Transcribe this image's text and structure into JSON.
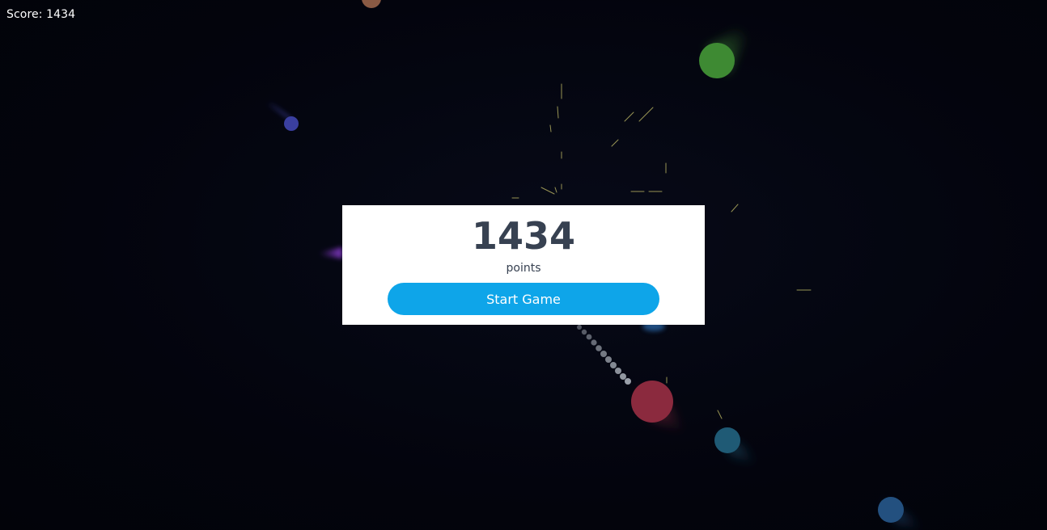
{
  "hud": {
    "score_text": "Score: 1434"
  },
  "modal": {
    "score_value": "1434",
    "points_label": "points",
    "start_button_label": "Start Game"
  },
  "colors": {
    "background": "#03040d",
    "modal_bg": "#ffffff",
    "score_text": "#374151",
    "button_bg": "#0ea5e9",
    "player": "#3a3f4a"
  },
  "entities": {
    "enemies": [
      {
        "name": "enemy-brown",
        "color": "#8a5a44"
      },
      {
        "name": "enemy-green",
        "color": "#3e8a33"
      },
      {
        "name": "enemy-indigo",
        "color": "#3a3fa0"
      },
      {
        "name": "enemy-purple",
        "color": "#7a3aa8"
      },
      {
        "name": "enemy-red",
        "color": "#8b2a3e"
      },
      {
        "name": "enemy-teal",
        "color": "#1f5a75"
      },
      {
        "name": "enemy-blue",
        "color": "#23507f"
      },
      {
        "name": "enemy-blue-small",
        "color": "#2b6cb0"
      }
    ]
  }
}
